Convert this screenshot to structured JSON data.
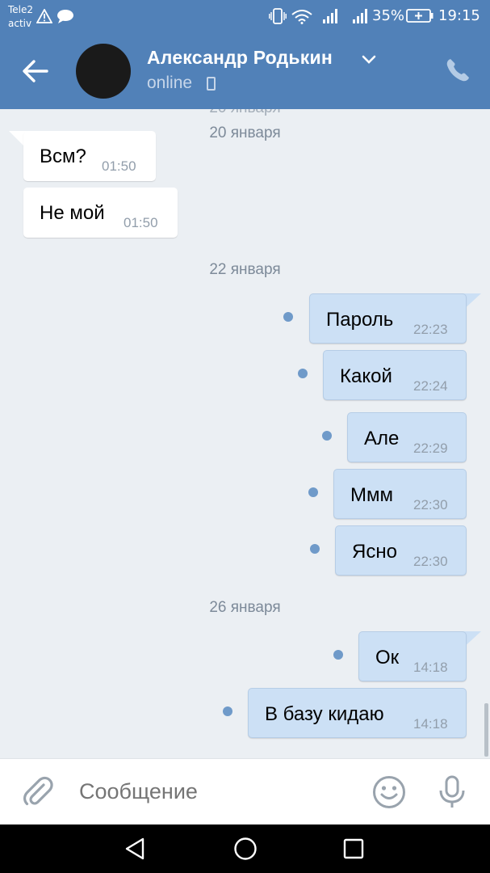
{
  "status_bar": {
    "carrier_line1": "Tele2",
    "carrier_line2": "activ",
    "battery": "35%",
    "time": "19:15"
  },
  "header": {
    "title": "Александр Родькин",
    "subtitle": "online"
  },
  "date_separators": [
    "20 января",
    "20 января",
    "22 января",
    "26 января"
  ],
  "messages": [
    {
      "direction": "incoming",
      "text": "Всм?",
      "time": "01:50"
    },
    {
      "direction": "incoming",
      "text": "Не мой",
      "time": "01:50"
    },
    {
      "direction": "outgoing",
      "text": "Пароль",
      "time": "22:23",
      "unread": true
    },
    {
      "direction": "outgoing",
      "text": "Какой",
      "time": "22:24",
      "unread": true
    },
    {
      "direction": "outgoing",
      "text": "Але",
      "time": "22:29",
      "unread": true
    },
    {
      "direction": "outgoing",
      "text": "Ммм",
      "time": "22:30",
      "unread": true
    },
    {
      "direction": "outgoing",
      "text": "Ясно",
      "time": "22:30",
      "unread": true
    },
    {
      "direction": "outgoing",
      "text": "Ок",
      "time": "14:18",
      "unread": true
    },
    {
      "direction": "outgoing",
      "text": "В базу кидаю",
      "time": "14:18",
      "unread": true
    }
  ],
  "composer": {
    "placeholder": "Сообщение"
  },
  "colors": {
    "header": "#5181b8",
    "chat_background": "#ebeff3",
    "incoming_bubble": "#ffffff",
    "outgoing_bubble": "#cce0f5",
    "unread_dot": "#6f9ac9"
  },
  "icons": {
    "back": "arrow-left-icon",
    "title_dropdown": "chevron-down-icon",
    "call": "phone-icon",
    "attach": "paperclip-icon",
    "emoji": "smiley-icon",
    "voice": "microphone-icon"
  }
}
